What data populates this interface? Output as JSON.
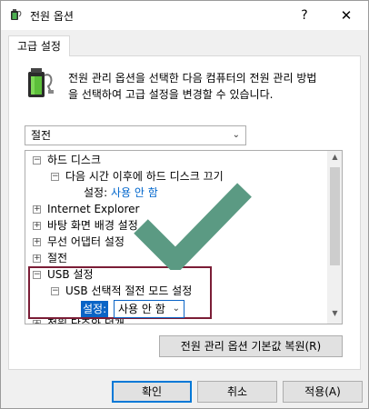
{
  "window": {
    "title": "전원 옵션",
    "help_glyph": "?",
    "close_glyph": "✕"
  },
  "tab": {
    "label": "고급 설정"
  },
  "description": {
    "line1": "전원 관리 옵션을 선택한 다음 컴퓨터의 전원 관리 방법",
    "line2": "을 선택하여 고급 설정을 변경할 수 있습니다."
  },
  "plan_select": {
    "value": "절전"
  },
  "tree": {
    "items": [
      {
        "label": "하드 디스크",
        "state": "expanded"
      },
      {
        "label": "다음 시간 이후에 하드 디스크 끄기",
        "state": "expanded"
      },
      {
        "label": "설정:",
        "value": "사용 안 함"
      },
      {
        "label": "Internet Explorer",
        "state": "collapsed"
      },
      {
        "label": "바탕 화면 배경 설정",
        "state": "collapsed"
      },
      {
        "label": "무선 어댑터 설정",
        "state": "collapsed"
      },
      {
        "label": "절전",
        "state": "collapsed"
      },
      {
        "label": "USB 설정",
        "state": "expanded"
      },
      {
        "label": "USB 선택적 절전 모드 설정",
        "state": "expanded"
      },
      {
        "label": "설정:",
        "value": "사용 안 함"
      },
      {
        "label": "전원 단추와 덮개"
      }
    ],
    "selected_setting_options": [
      "사용 안 함"
    ]
  },
  "buttons": {
    "restore": "전원 관리 옵션 기본값 복원(R)",
    "ok": "확인",
    "cancel": "취소",
    "apply": "적용(A)"
  },
  "colors": {
    "highlight_border": "#7b1d36",
    "checkmark": "#5b9a83",
    "link": "#0066cc",
    "selection": "#0a64c6"
  },
  "icons": {
    "title": "power-options-icon",
    "main": "battery-icon",
    "overlay": "checkmark-icon"
  }
}
